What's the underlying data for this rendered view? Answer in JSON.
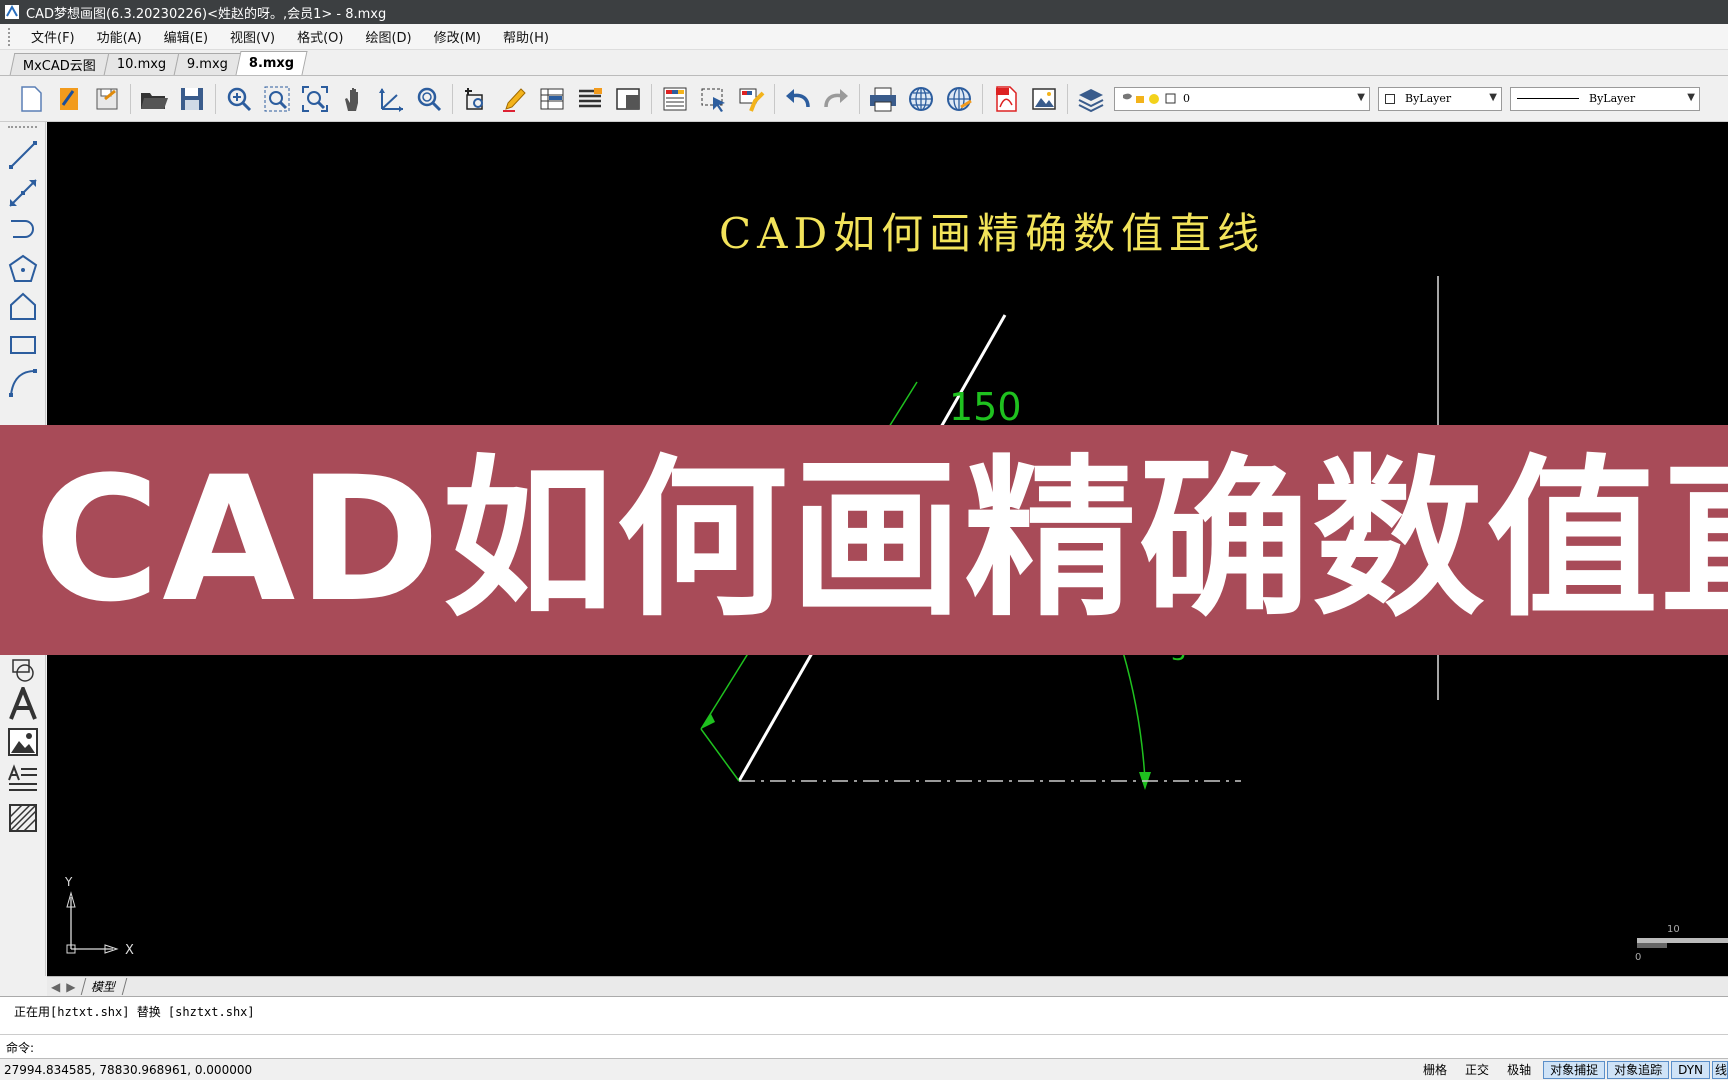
{
  "window": {
    "title": "CAD梦想画图(6.3.20230226)<姓赵的呀。,会员1> - 8.mxg"
  },
  "menu": [
    "文件(F)",
    "功能(A)",
    "编辑(E)",
    "视图(V)",
    "格式(O)",
    "绘图(D)",
    "修改(M)",
    "帮助(H)"
  ],
  "tabs": [
    {
      "label": "MxCAD云图",
      "active": false
    },
    {
      "label": "10.mxg",
      "active": false
    },
    {
      "label": "9.mxg",
      "active": false
    },
    {
      "label": "8.mxg",
      "active": true
    }
  ],
  "toolbar": {
    "layer_value": "0",
    "color_value": "ByLayer",
    "linetype_value": "ByLayer"
  },
  "drawing": {
    "title_text": "CAD如何画精确数值直线",
    "dim_length": "150",
    "dim_angle_fragment": "3",
    "ucs_x": "X",
    "ucs_y": "Y",
    "scale_0": "0",
    "scale_10": "10",
    "colors": {
      "title": "#f2e35a",
      "dimension": "#1fc11f",
      "line": "#ffffff"
    }
  },
  "model_tab": "模型",
  "command": {
    "history": "正在用[hztxt.shx] 替换 [shztxt.shx]",
    "prompt": "命令:"
  },
  "status": {
    "coords": "27994.834585,  78830.968961,  0.000000",
    "buttons": [
      {
        "label": "栅格",
        "on": false
      },
      {
        "label": "正交",
        "on": false
      },
      {
        "label": "极轴",
        "on": false
      },
      {
        "label": "对象捕捉",
        "on": true
      },
      {
        "label": "对象追踪",
        "on": true
      },
      {
        "label": "DYN",
        "on": true
      },
      {
        "label": "线",
        "on": true
      }
    ]
  },
  "banner": {
    "text": "CAD如何画精确数值直线",
    "color": "#a84b58"
  }
}
